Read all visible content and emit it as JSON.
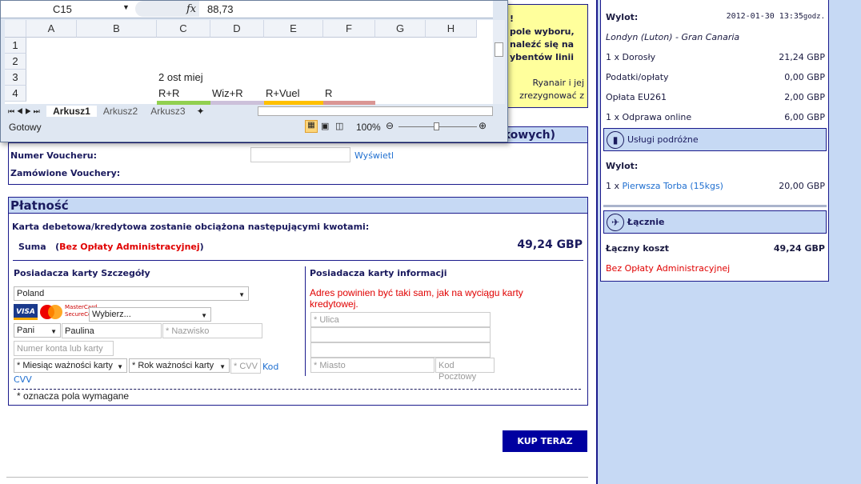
{
  "excel": {
    "name_box": "C15",
    "fx": "fx",
    "formula": "88,73",
    "columns": [
      "A",
      "B",
      "C",
      "D",
      "E",
      "F",
      "G",
      "H"
    ],
    "rows": [
      "1",
      "2",
      "3",
      "4"
    ],
    "cells": {
      "c3": "2 ost miej",
      "c4": "R+R",
      "d4": "Wiz+R",
      "e4": "R+Vuel",
      "f4": "R"
    },
    "cell_colors": {
      "c4": "#92d050",
      "d4": "#ccc0da",
      "e4": "#ffc000",
      "f4": "#da9694"
    },
    "sheets": [
      "Arkusz1",
      "Arkusz2",
      "Arkusz3"
    ],
    "status": "Gotowy",
    "zoom": "100%"
  },
  "yellow": {
    "line1": "!",
    "line2": "pole wyboru,",
    "line3": "naleźć się na",
    "line4": "ybentów linii",
    "line5": "Ryanair i jej",
    "line6": "zrezygnować z"
  },
  "voucher": {
    "header_fragment": "kowych)",
    "number_label": "Numer Voucheru:",
    "show_link": "Wyświetl",
    "ordered_label": "Zamówione Vouchery:"
  },
  "payment": {
    "title": "Płatność",
    "intro": "Karta debetowa/kredytowa zostanie obciążona następującymi kwotami:",
    "sum_label": "Suma",
    "sum_note_open": "(",
    "sum_note": "Bez Opłaty Administracyjnej",
    "sum_note_close": ")",
    "sum_value": "49,24 GBP",
    "left_title": "Posiadacza karty Szczegóły",
    "country": "Poland",
    "card_type": "Wybierz...",
    "title_sel": "Pani",
    "first_name": "Paulina",
    "surname_ph": "* Nazwisko",
    "account_ph": "Numer konta lub karty",
    "month_sel": "* Miesiąc ważności karty",
    "year_sel": "* Rok ważności karty",
    "cvv_ph": "* CVV",
    "cvv_link1": "Kod",
    "cvv_link2": "CVV",
    "right_title": "Posiadacza karty informacji",
    "address_note": "Adres powinien być taki sam, jak na wyciągu karty kredytowej.",
    "street_ph": "* Ulica",
    "city_ph": "* Miasto",
    "postcode_ph": "Kod Pocztowy",
    "required_note": "* oznacza pola wymagane",
    "buy_button": "KUP TERAZ"
  },
  "summary": {
    "departure_label": "Wylot:",
    "departure_date": "2012-01-30 13:35",
    "departure_unit": "godz.",
    "route": "Londyn (Luton) - Gran Canaria",
    "lines": [
      {
        "label": "1 x Dorosły",
        "value": "21,24 GBP"
      },
      {
        "label": "Podatki/opłaty",
        "value": "0,00 GBP"
      },
      {
        "label": "Opłata EU261",
        "value": "2,00 GBP"
      },
      {
        "label": "1 x Odprawa online",
        "value": "6,00 GBP"
      }
    ],
    "services_title": "Usługi podróżne",
    "services_departure": "Wylot:",
    "bag_prefix": "1 x",
    "bag_link": "Pierwsza Torba (15kgs)",
    "bag_value": "20,00 GBP",
    "total_title": "Łącznie",
    "total_label": "Łączny koszt",
    "total_value": "49,24 GBP",
    "total_note": "Bez Opłaty Administracyjnej"
  },
  "colors": {
    "navy": "#1a1a8c",
    "light_blue": "#c6d9f4",
    "red": "#e00000",
    "link": "#1f6fd0",
    "button": "#0000a0",
    "yellow": "#ffff9c"
  }
}
